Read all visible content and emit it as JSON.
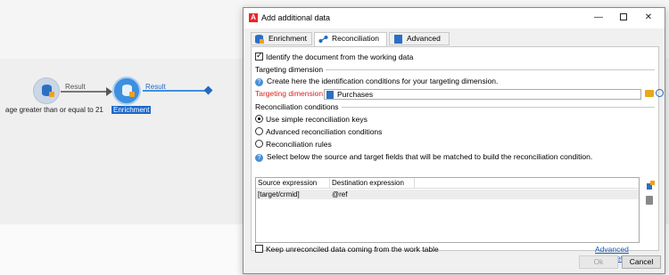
{
  "workflow": {
    "link1_label": "Result",
    "link2_label": "Result",
    "node1_label": "age greater than or equal to 21",
    "node2_label": "Enrichment"
  },
  "dialog": {
    "title": "Add additional data",
    "tabs": [
      {
        "label": "Enrichment",
        "icon": "enrichment-icon"
      },
      {
        "label": "Reconciliation",
        "icon": "reconciliation-icon",
        "active": true
      },
      {
        "label": "Advanced",
        "icon": "advanced-icon"
      }
    ],
    "identify_label": "Identify the document from the working data",
    "identify_checked": true,
    "targeting_section": "Targeting dimension",
    "targeting_help": "Create here the identification conditions for your targeting dimension.",
    "targeting_label": "Targeting dimension:",
    "targeting_value": "Purchases",
    "recon_section": "Reconciliation conditions",
    "options": [
      {
        "label": "Use simple reconciliation keys",
        "selected": true
      },
      {
        "label": "Advanced reconciliation conditions",
        "selected": false
      },
      {
        "label": "Reconciliation rules",
        "selected": false
      }
    ],
    "fields_help": "Select below the source and target fields that will be matched to build the reconciliation condition.",
    "grid": {
      "headers": [
        "Source expression",
        "Destination expression"
      ],
      "rows": [
        [
          "[target/crmid]",
          "@ref"
        ]
      ]
    },
    "keep_label": "Keep unreconciled data coming from the work table",
    "keep_checked": false,
    "advanced_params": "Advanced parameters...",
    "ok": "Ok",
    "cancel": "Cancel"
  },
  "colors": {
    "accent": "#3d8fe0",
    "required": "#e02020",
    "link": "#1a5fbf"
  }
}
